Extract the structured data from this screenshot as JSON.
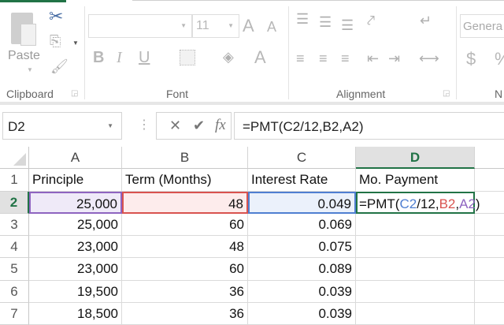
{
  "ribbon": {
    "clipboard": {
      "paste_label": "Paste",
      "group_label": "Clipboard"
    },
    "font": {
      "font_name": "",
      "font_size": "11",
      "group_label": "Font",
      "bold": "B",
      "italic": "I",
      "underline": "U",
      "font_color": "A",
      "grow": "A",
      "shrink": "A"
    },
    "alignment": {
      "group_label": "Alignment"
    },
    "number": {
      "format": "Genera",
      "currency": "$",
      "percent": "%",
      "group_label": "N"
    }
  },
  "formula_bar": {
    "name_box": "D2",
    "fx_label": "fx",
    "cancel": "✕",
    "enter": "✔",
    "formula": "=PMT(C2/12,B2,A2)"
  },
  "colors": {
    "accent": "#217346",
    "ref_c2": "#4f7fd1",
    "ref_b2": "#d9534f",
    "ref_a2": "#8e64c0"
  },
  "sheet": {
    "columns": [
      "A",
      "B",
      "C",
      "D"
    ],
    "rows": [
      "1",
      "2",
      "3",
      "4",
      "5",
      "6",
      "7"
    ],
    "headers": [
      "Principle",
      "Term (Months)",
      "Interest Rate",
      "Mo. Payment"
    ],
    "data": [
      [
        "25,000",
        "48",
        "0.049"
      ],
      [
        "25,000",
        "60",
        "0.069"
      ],
      [
        "23,000",
        "48",
        "0.075"
      ],
      [
        "23,000",
        "60",
        "0.089"
      ],
      [
        "19,500",
        "36",
        "0.039"
      ],
      [
        "18,500",
        "36",
        "0.039"
      ]
    ],
    "active_cell": {
      "prefix": "=PMT(",
      "c2": "C2",
      "mid": "/12,",
      "b2": "B2",
      "comma": ",",
      "a2": "A2",
      "suffix": ")"
    }
  }
}
